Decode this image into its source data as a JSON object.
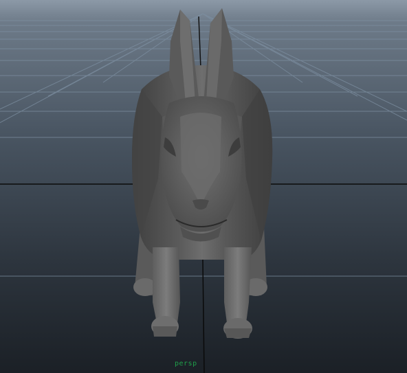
{
  "viewport": {
    "camera_label": "persp",
    "colors": {
      "sky_top": "#8b98a6",
      "horizon_top": "#5c6977",
      "horizon_bottom": "#1c2229",
      "grid_line": "#6b7c8d",
      "grid_axis": "#000000",
      "model_fill": "#565656",
      "model_shadow": "#3a3a3a",
      "model_highlight": "#7a7a7a",
      "label": "#1fa04a"
    }
  },
  "scene": {
    "object": "rabbit-mesh",
    "grid": "ground-grid",
    "selection_pivot": "pivot-line"
  }
}
